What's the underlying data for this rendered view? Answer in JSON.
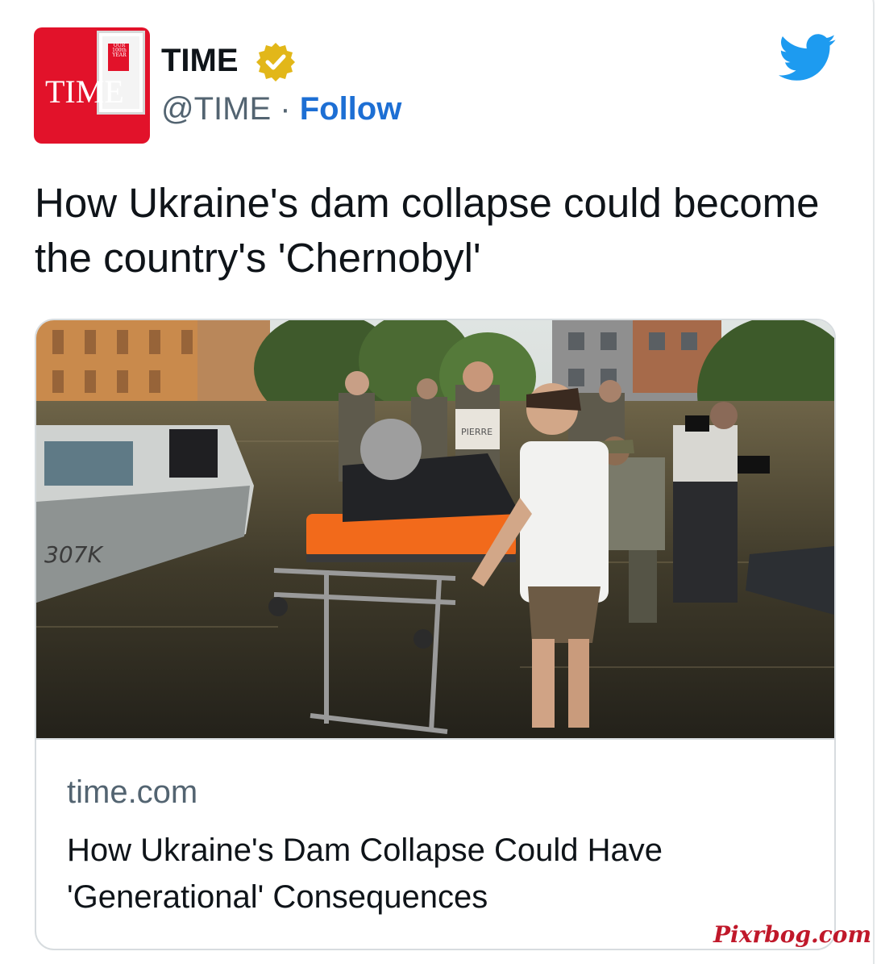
{
  "account": {
    "avatar_word": "TIME",
    "avatar_badge": "OUR\n100th\nYEAR",
    "name": "TIME",
    "handle": "@TIME",
    "separator": " · ",
    "follow_label": "Follow"
  },
  "tweet": {
    "text": "How Ukraine's dam collapse could become the country's 'Chernobyl'"
  },
  "link_card": {
    "domain": "time.com",
    "title": "How Ukraine's Dam Collapse Could Have 'Generational' Consequences",
    "photo_boat_text": "307K",
    "photo_shirt_text": "PIERRE"
  },
  "watermark": "Pixrbog.com",
  "colors": {
    "time_red": "#e2122a",
    "follow_blue": "#1d6fd4",
    "twitter_blue": "#1d9bf0",
    "verified_gold": "#e2b719",
    "text_primary": "#0f1419",
    "text_secondary": "#536471",
    "watermark_red": "#c0182a"
  },
  "icons": {
    "verified": "verified-badge-icon",
    "brand": "twitter-bird-icon"
  }
}
